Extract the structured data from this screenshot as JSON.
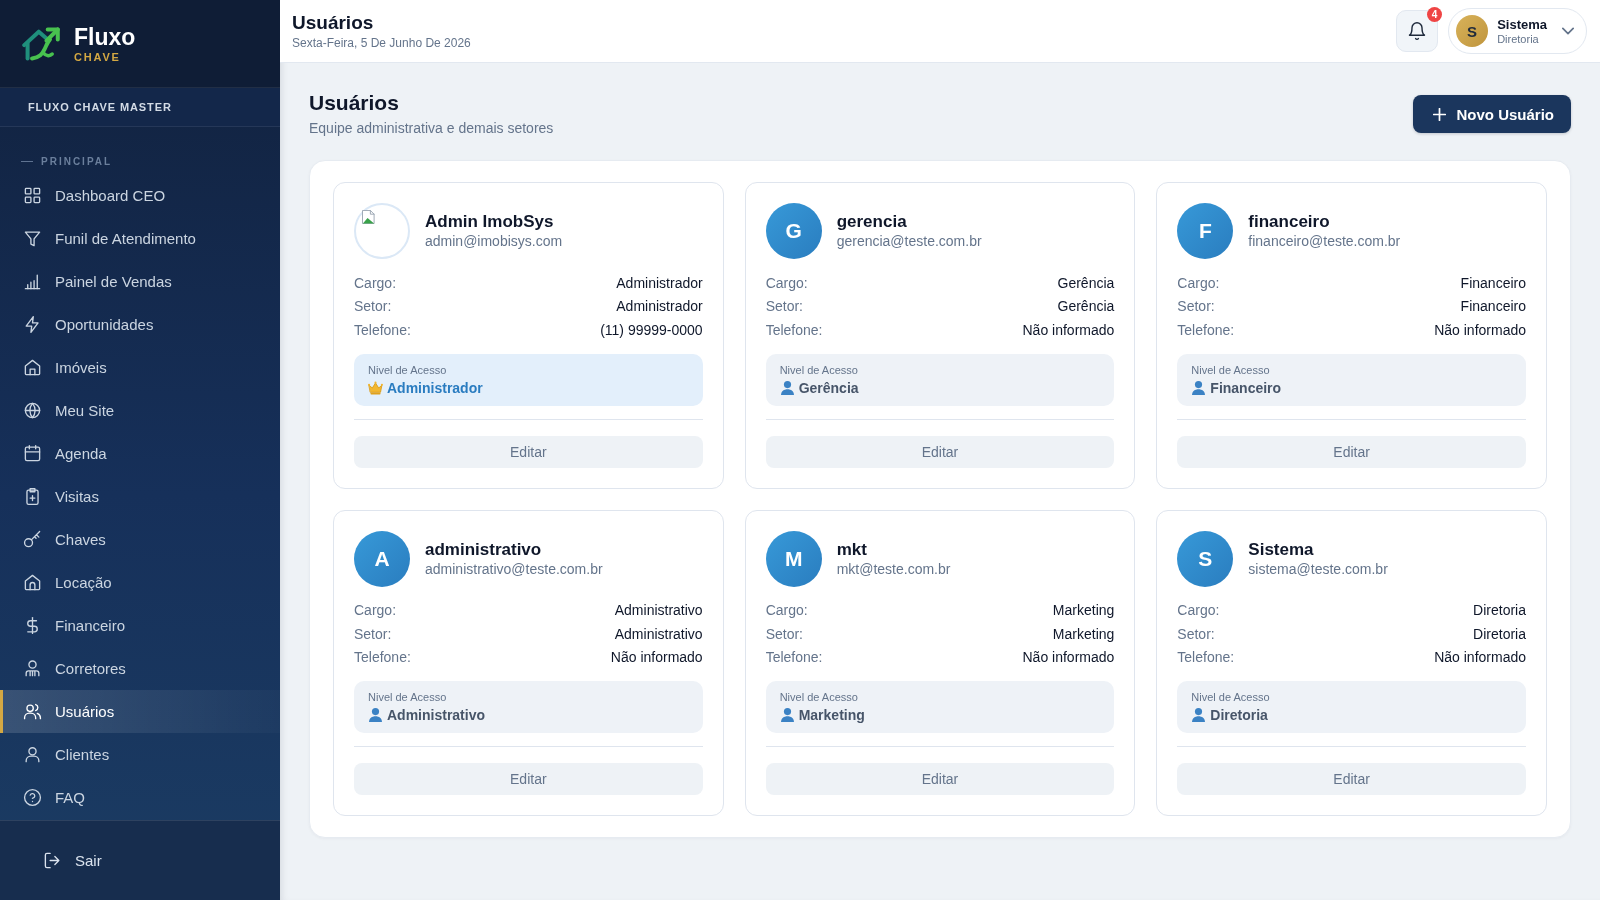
{
  "sidebar": {
    "logo": {
      "title": "Fluxo",
      "subtitle": "CHAVE"
    },
    "workspace": "FLUXO CHAVE MASTER",
    "section": "PRINCIPAL",
    "items": [
      {
        "label": "Dashboard CEO",
        "selected": false
      },
      {
        "label": "Funil de Atendimento",
        "selected": false
      },
      {
        "label": "Painel de Vendas",
        "selected": false
      },
      {
        "label": "Oportunidades",
        "selected": false
      },
      {
        "label": "Imóveis",
        "selected": false
      },
      {
        "label": "Meu Site",
        "selected": false
      },
      {
        "label": "Agenda",
        "selected": false
      },
      {
        "label": "Visitas",
        "selected": false
      },
      {
        "label": "Chaves",
        "selected": false
      },
      {
        "label": "Locação",
        "selected": false
      },
      {
        "label": "Financeiro",
        "selected": false
      },
      {
        "label": "Corretores",
        "selected": false
      },
      {
        "label": "Usuários",
        "selected": true
      },
      {
        "label": "Clientes",
        "selected": false
      },
      {
        "label": "FAQ",
        "selected": false
      }
    ],
    "logout": "Sair"
  },
  "header": {
    "title": "Usuários",
    "date": "Sexta-Feira, 5 De Junho De 2026",
    "notifications": {
      "count": "4"
    },
    "user": {
      "initial": "S",
      "name": "Sistema",
      "role": "Diretoria"
    }
  },
  "page": {
    "title": "Usuários",
    "subtitle": "Equipe administrativa e demais setores",
    "new_button": "Novo Usuário"
  },
  "users": [
    {
      "avatar": {
        "kind": "image"
      },
      "name": "Admin ImobSys",
      "email": "admin@imobisys.com",
      "fields": [
        {
          "label": "Cargo:",
          "value": "Administrador"
        },
        {
          "label": "Setor:",
          "value": "Administrador"
        },
        {
          "label": "Telefone:",
          "value": "(11) 99999-0000"
        }
      ],
      "access": {
        "label": "Nivel de Acesso",
        "value": "Administrador",
        "kind": "admin"
      },
      "edit_button": "Editar"
    },
    {
      "avatar": {
        "kind": "initial",
        "initial": "G"
      },
      "name": "gerencia",
      "email": "gerencia@teste.com.br",
      "fields": [
        {
          "label": "Cargo:",
          "value": "Gerência"
        },
        {
          "label": "Setor:",
          "value": "Gerência"
        },
        {
          "label": "Telefone:",
          "value": "Não informado"
        }
      ],
      "access": {
        "label": "Nivel de Acesso",
        "value": "Gerência",
        "kind": "user"
      },
      "edit_button": "Editar"
    },
    {
      "avatar": {
        "kind": "initial",
        "initial": "F"
      },
      "name": "financeiro",
      "email": "financeiro@teste.com.br",
      "fields": [
        {
          "label": "Cargo:",
          "value": "Financeiro"
        },
        {
          "label": "Setor:",
          "value": "Financeiro"
        },
        {
          "label": "Telefone:",
          "value": "Não informado"
        }
      ],
      "access": {
        "label": "Nivel de Acesso",
        "value": "Financeiro",
        "kind": "user"
      },
      "edit_button": "Editar"
    },
    {
      "avatar": {
        "kind": "initial",
        "initial": "A"
      },
      "name": "administrativo",
      "email": "administrativo@teste.com.br",
      "fields": [
        {
          "label": "Cargo:",
          "value": "Administrativo"
        },
        {
          "label": "Setor:",
          "value": "Administrativo"
        },
        {
          "label": "Telefone:",
          "value": "Não informado"
        }
      ],
      "access": {
        "label": "Nivel de Acesso",
        "value": "Administrativo",
        "kind": "user"
      },
      "edit_button": "Editar"
    },
    {
      "avatar": {
        "kind": "initial",
        "initial": "M"
      },
      "name": "mkt",
      "email": "mkt@teste.com.br",
      "fields": [
        {
          "label": "Cargo:",
          "value": "Marketing"
        },
        {
          "label": "Setor:",
          "value": "Marketing"
        },
        {
          "label": "Telefone:",
          "value": "Não informado"
        }
      ],
      "access": {
        "label": "Nivel de Acesso",
        "value": "Marketing",
        "kind": "user"
      },
      "edit_button": "Editar"
    },
    {
      "avatar": {
        "kind": "initial",
        "initial": "S"
      },
      "name": "Sistema",
      "email": "sistema@teste.com.br",
      "fields": [
        {
          "label": "Cargo:",
          "value": "Diretoria"
        },
        {
          "label": "Setor:",
          "value": "Diretoria"
        },
        {
          "label": "Telefone:",
          "value": "Não informado"
        }
      ],
      "access": {
        "label": "Nivel de Acesso",
        "value": "Diretoria",
        "kind": "user"
      },
      "edit_button": "Editar"
    }
  ]
}
